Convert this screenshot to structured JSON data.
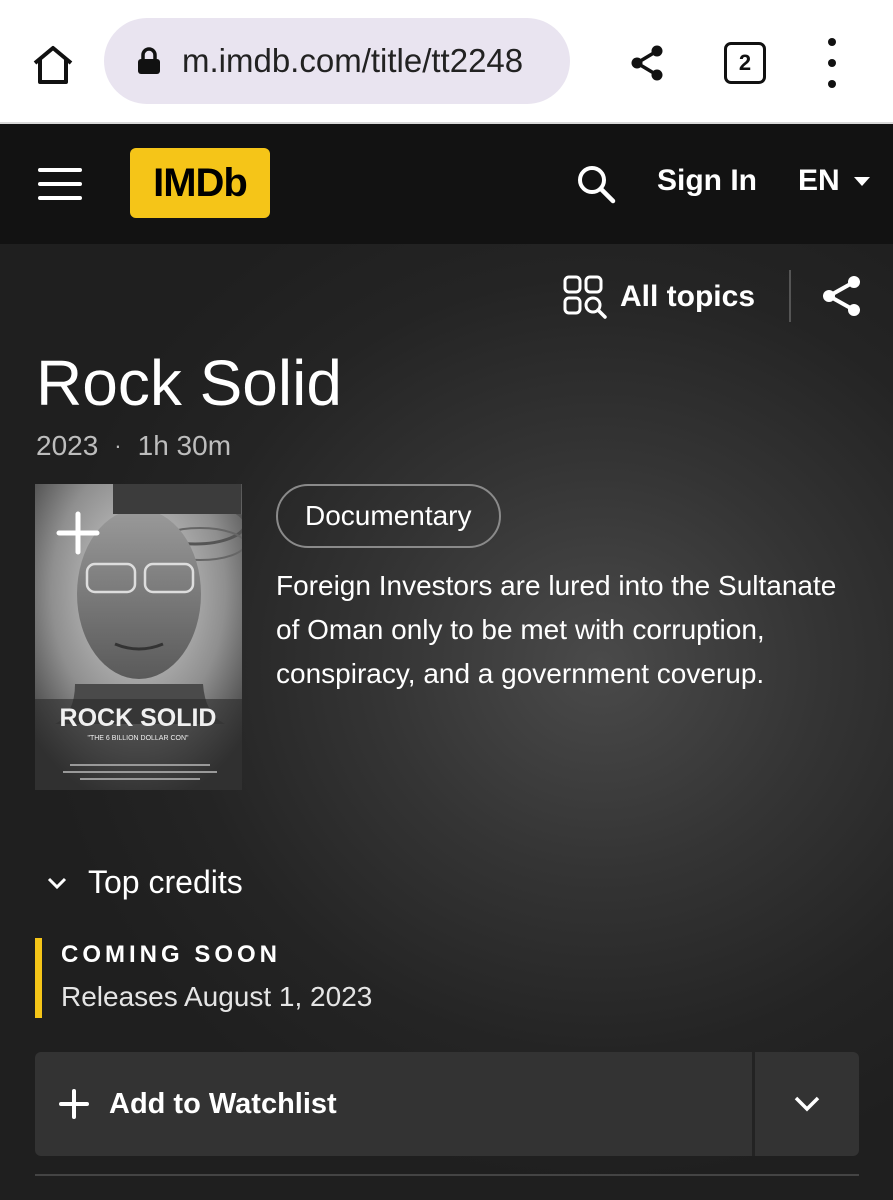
{
  "browser": {
    "url": "m.imdb.com/title/tt2248",
    "tab_count": "2"
  },
  "header": {
    "logo": "IMDb",
    "sign_in": "Sign In",
    "language": "EN"
  },
  "hero": {
    "all_topics": "All topics",
    "title": "Rock Solid",
    "year": "2023",
    "meta_separator": "·",
    "runtime": "1h 30m",
    "genre": "Documentary",
    "plot": "Foreign Investors are lured into the Sultanate of Oman only to be met with corruption, conspiracy, and a government coverup.",
    "poster": {
      "title_text": "ROCK SOLID",
      "tagline": "\"THE 6 BILLION DOLLAR CON\""
    },
    "top_credits": "Top credits",
    "coming_soon": "COMING SOON",
    "release": "Releases August 1, 2023",
    "watchlist_label": "Add to Watchlist"
  },
  "colors": {
    "imdb_yellow": "#f5c518",
    "header_bg": "#121212",
    "button_bg": "#333333"
  }
}
